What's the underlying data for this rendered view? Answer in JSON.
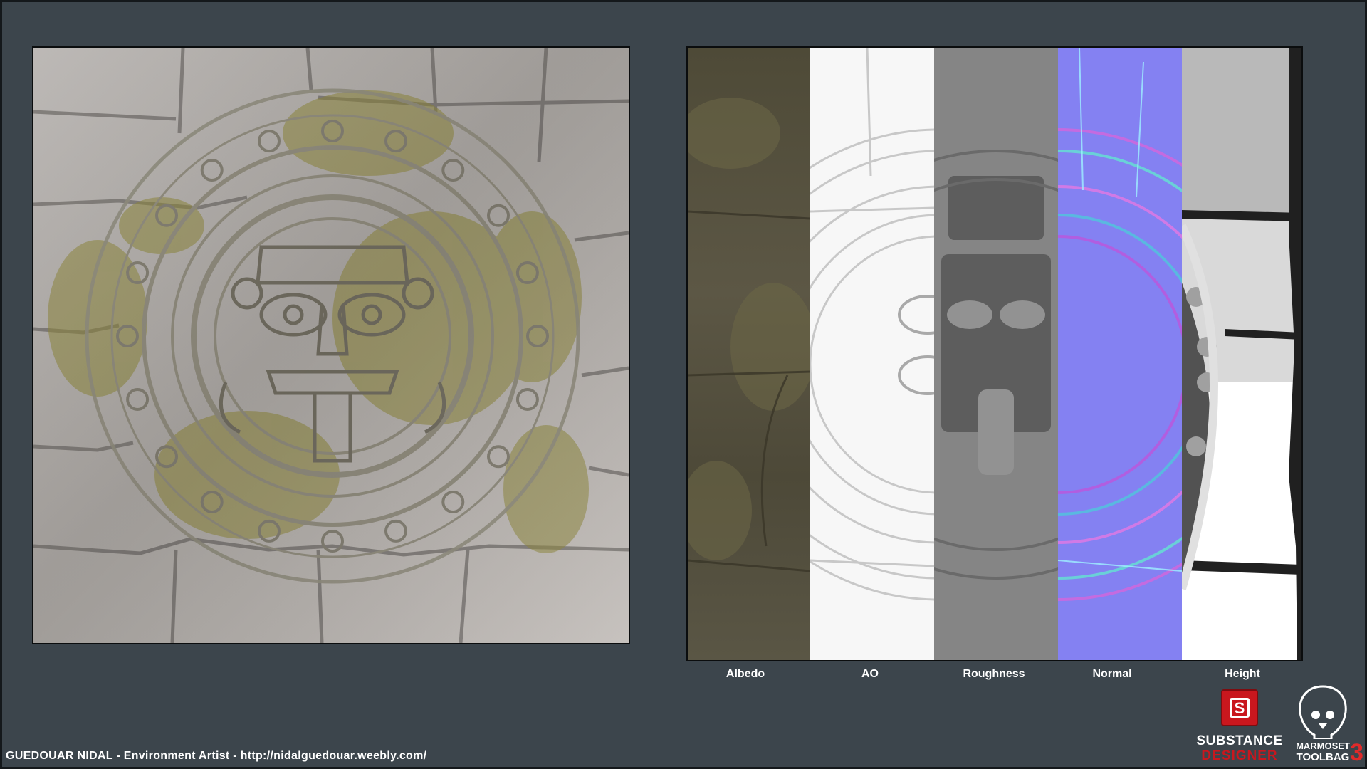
{
  "render": {
    "subject": "Carved stone sun calendar floor texture"
  },
  "channels": [
    {
      "id": "albedo",
      "label": "Albedo"
    },
    {
      "id": "ao",
      "label": "AO"
    },
    {
      "id": "roughness",
      "label": "Roughness"
    },
    {
      "id": "normal",
      "label": "Normal"
    },
    {
      "id": "height",
      "label": "Height"
    }
  ],
  "footer": {
    "credit": "GUEDOUAR NIDAL - Environment Artist - http://nidalguedouar.weebly.com/"
  },
  "logos": {
    "substance": {
      "line1": "SUBSTANCE",
      "line2": "DESIGNER",
      "mark": "S"
    },
    "marmoset": {
      "line1": "MARMOSET",
      "line2": "TOOLBAG",
      "version": "3"
    }
  },
  "colors": {
    "background": "#3c454c",
    "substance_red": "#c9171e",
    "normal_blue": "#8481f2"
  }
}
